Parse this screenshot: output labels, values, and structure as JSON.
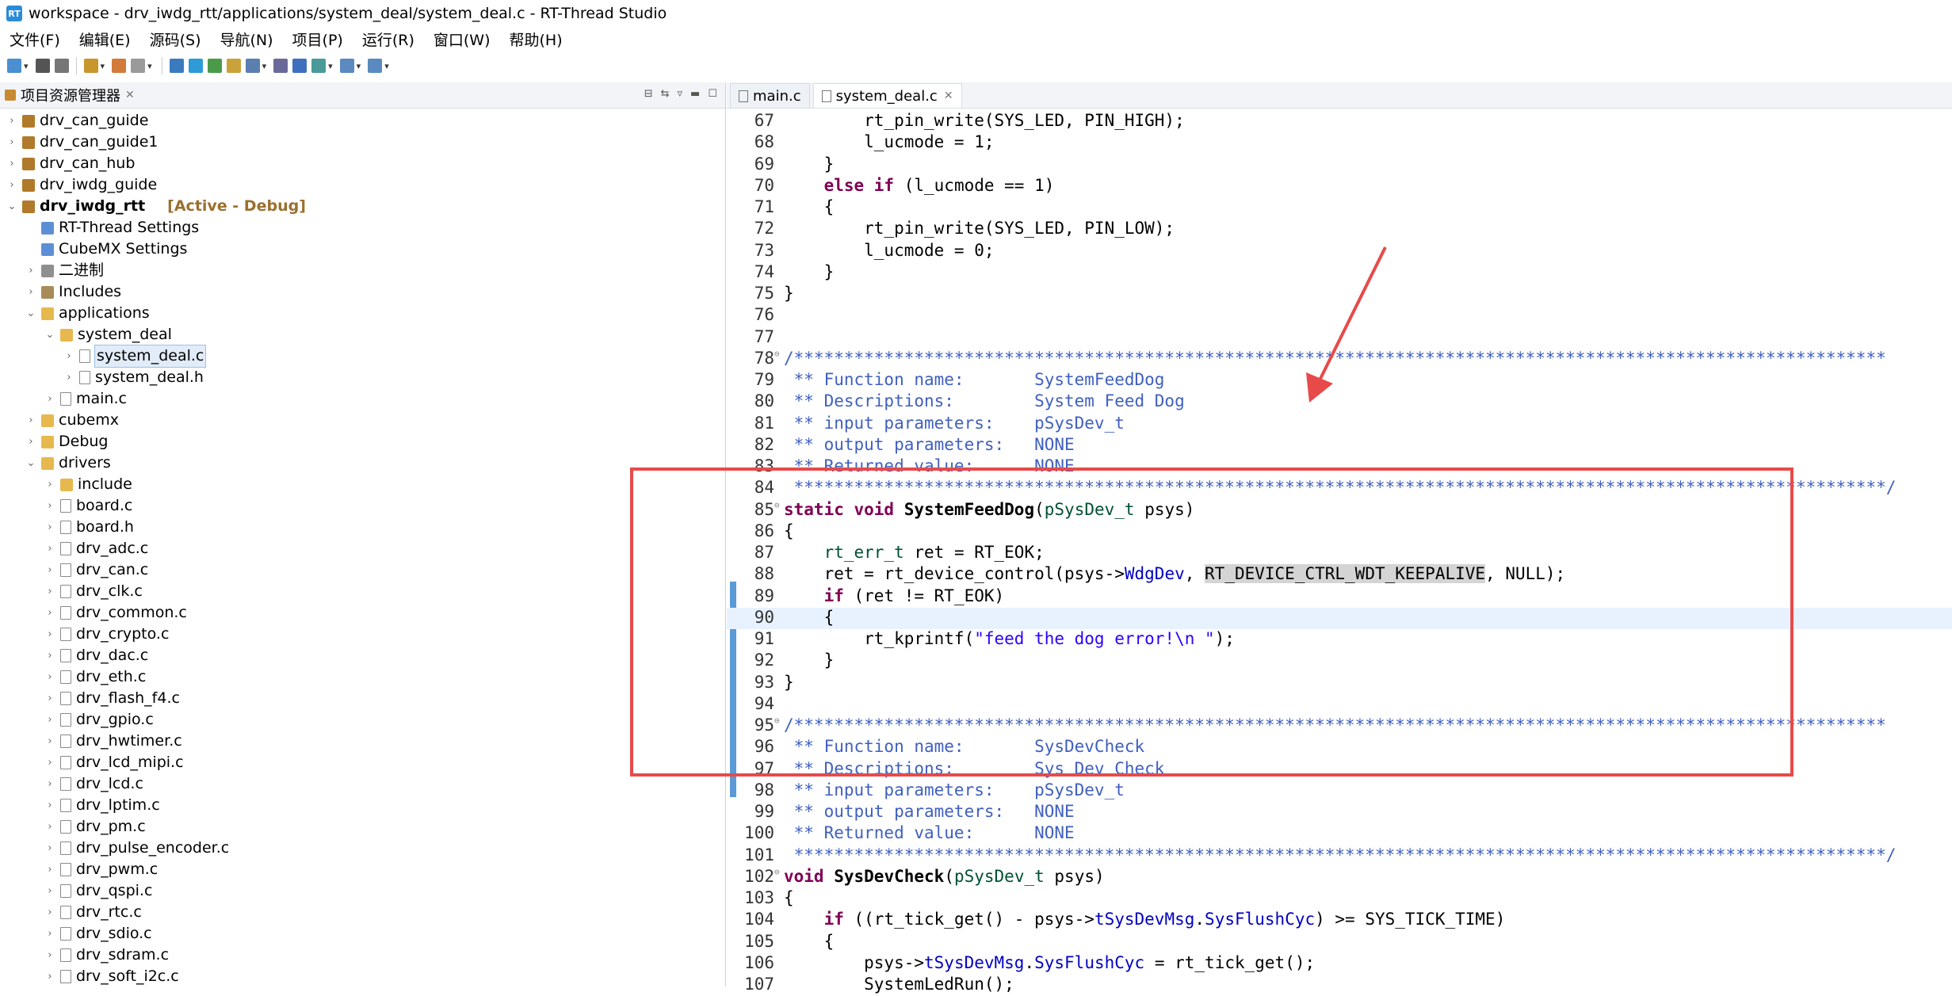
{
  "window": {
    "title": "workspace - drv_iwdg_rtt/applications/system_deal/system_deal.c - RT-Thread Studio"
  },
  "menubar": [
    "文件(F)",
    "编辑(E)",
    "源码(S)",
    "导航(N)",
    "项目(P)",
    "运行(R)",
    "窗口(W)",
    "帮助(H)"
  ],
  "explorer": {
    "title": "项目资源管理器",
    "active_tag": "[Active - Debug]",
    "items": [
      {
        "label": "drv_can_guide",
        "level": 0,
        "chev": "›",
        "icon": "proj"
      },
      {
        "label": "drv_can_guide1",
        "level": 0,
        "chev": "›",
        "icon": "proj"
      },
      {
        "label": "drv_can_hub",
        "level": 0,
        "chev": "›",
        "icon": "proj"
      },
      {
        "label": "drv_iwdg_guide",
        "level": 0,
        "chev": "›",
        "icon": "proj"
      },
      {
        "label": "drv_iwdg_rtt",
        "level": 0,
        "chev": "⌄",
        "icon": "proj",
        "bold": true,
        "active": true
      },
      {
        "label": "RT-Thread Settings",
        "level": 1,
        "chev": "",
        "icon": "cfg"
      },
      {
        "label": "CubeMX Settings",
        "level": 1,
        "chev": "",
        "icon": "cfg"
      },
      {
        "label": "二进制",
        "level": 1,
        "chev": "›",
        "icon": "bin"
      },
      {
        "label": "Includes",
        "level": 1,
        "chev": "›",
        "icon": "inc"
      },
      {
        "label": "applications",
        "level": 1,
        "chev": "⌄",
        "icon": "folder"
      },
      {
        "label": "system_deal",
        "level": 2,
        "chev": "⌄",
        "icon": "folder"
      },
      {
        "label": "system_deal.c",
        "level": 3,
        "chev": "›",
        "icon": "file",
        "selected": true
      },
      {
        "label": "system_deal.h",
        "level": 3,
        "chev": "›",
        "icon": "file"
      },
      {
        "label": "main.c",
        "level": 2,
        "chev": "›",
        "icon": "file"
      },
      {
        "label": "cubemx",
        "level": 1,
        "chev": "›",
        "icon": "folder"
      },
      {
        "label": "Debug",
        "level": 1,
        "chev": "›",
        "icon": "folder"
      },
      {
        "label": "drivers",
        "level": 1,
        "chev": "⌄",
        "icon": "folder"
      },
      {
        "label": "include",
        "level": 2,
        "chev": "›",
        "icon": "folder"
      },
      {
        "label": "board.c",
        "level": 2,
        "chev": "›",
        "icon": "file"
      },
      {
        "label": "board.h",
        "level": 2,
        "chev": "›",
        "icon": "file"
      },
      {
        "label": "drv_adc.c",
        "level": 2,
        "chev": "›",
        "icon": "file"
      },
      {
        "label": "drv_can.c",
        "level": 2,
        "chev": "›",
        "icon": "file"
      },
      {
        "label": "drv_clk.c",
        "level": 2,
        "chev": "›",
        "icon": "file"
      },
      {
        "label": "drv_common.c",
        "level": 2,
        "chev": "›",
        "icon": "file"
      },
      {
        "label": "drv_crypto.c",
        "level": 2,
        "chev": "›",
        "icon": "file"
      },
      {
        "label": "drv_dac.c",
        "level": 2,
        "chev": "›",
        "icon": "file"
      },
      {
        "label": "drv_eth.c",
        "level": 2,
        "chev": "›",
        "icon": "file"
      },
      {
        "label": "drv_flash_f4.c",
        "level": 2,
        "chev": "›",
        "icon": "file"
      },
      {
        "label": "drv_gpio.c",
        "level": 2,
        "chev": "›",
        "icon": "file"
      },
      {
        "label": "drv_hwtimer.c",
        "level": 2,
        "chev": "›",
        "icon": "file"
      },
      {
        "label": "drv_lcd_mipi.c",
        "level": 2,
        "chev": "›",
        "icon": "file"
      },
      {
        "label": "drv_lcd.c",
        "level": 2,
        "chev": "›",
        "icon": "file"
      },
      {
        "label": "drv_lptim.c",
        "level": 2,
        "chev": "›",
        "icon": "file"
      },
      {
        "label": "drv_pm.c",
        "level": 2,
        "chev": "›",
        "icon": "file"
      },
      {
        "label": "drv_pulse_encoder.c",
        "level": 2,
        "chev": "›",
        "icon": "file"
      },
      {
        "label": "drv_pwm.c",
        "level": 2,
        "chev": "›",
        "icon": "file"
      },
      {
        "label": "drv_qspi.c",
        "level": 2,
        "chev": "›",
        "icon": "file"
      },
      {
        "label": "drv_rtc.c",
        "level": 2,
        "chev": "›",
        "icon": "file"
      },
      {
        "label": "drv_sdio.c",
        "level": 2,
        "chev": "›",
        "icon": "file"
      },
      {
        "label": "drv_sdram.c",
        "level": 2,
        "chev": "›",
        "icon": "file"
      },
      {
        "label": "drv_soft_i2c.c",
        "level": 2,
        "chev": "›",
        "icon": "file"
      }
    ]
  },
  "editor": {
    "tabs": [
      {
        "label": "main.c",
        "active": false
      },
      {
        "label": "system_deal.c",
        "active": true
      }
    ],
    "lines": [
      {
        "n": "67",
        "fold": "",
        "segs": [
          [
            "",
            "        rt_pin_write(SYS_LED, PIN_HIGH);"
          ]
        ]
      },
      {
        "n": "68",
        "fold": "",
        "segs": [
          [
            "",
            "        l_ucmode = 1;"
          ]
        ]
      },
      {
        "n": "69",
        "fold": "",
        "segs": [
          [
            "",
            "    }"
          ]
        ]
      },
      {
        "n": "70",
        "fold": "",
        "segs": [
          [
            "",
            "    "
          ],
          [
            "kw",
            "else if"
          ],
          [
            "",
            " (l_ucmode == 1)"
          ]
        ]
      },
      {
        "n": "71",
        "fold": "",
        "segs": [
          [
            "",
            "    {"
          ]
        ]
      },
      {
        "n": "72",
        "fold": "",
        "segs": [
          [
            "",
            "        rt_pin_write(SYS_LED, PIN_LOW);"
          ]
        ]
      },
      {
        "n": "73",
        "fold": "",
        "segs": [
          [
            "",
            "        l_ucmode = 0;"
          ]
        ]
      },
      {
        "n": "74",
        "fold": "",
        "segs": [
          [
            "",
            "    }"
          ]
        ]
      },
      {
        "n": "75",
        "fold": "",
        "segs": [
          [
            "",
            "}"
          ]
        ]
      },
      {
        "n": "76",
        "fold": "",
        "segs": []
      },
      {
        "n": "77",
        "fold": "",
        "segs": []
      },
      {
        "n": "78",
        "fold": "⊖",
        "segs": [
          [
            "cm",
            "/*************************************************************************************************************"
          ]
        ]
      },
      {
        "n": "79",
        "fold": "",
        "segs": [
          [
            "cm",
            " ** Function name:       SystemFeedDog"
          ]
        ]
      },
      {
        "n": "80",
        "fold": "",
        "segs": [
          [
            "cm",
            " ** Descriptions:        System Feed Dog"
          ]
        ]
      },
      {
        "n": "81",
        "fold": "",
        "segs": [
          [
            "cm",
            " ** input parameters:    pSysDev_t"
          ]
        ]
      },
      {
        "n": "82",
        "fold": "",
        "segs": [
          [
            "cm",
            " ** output parameters:   NONE"
          ]
        ]
      },
      {
        "n": "83",
        "fold": "",
        "segs": [
          [
            "cm",
            " ** Returned value:      NONE"
          ]
        ]
      },
      {
        "n": "84",
        "fold": "",
        "segs": [
          [
            "cm",
            " *************************************************************************************************************/"
          ]
        ]
      },
      {
        "n": "85",
        "fold": "⊖",
        "segs": [
          [
            "kw",
            "static void"
          ],
          [
            "",
            " "
          ],
          [
            "fn",
            "SystemFeedDog"
          ],
          [
            "",
            "("
          ],
          [
            "ty",
            "pSysDev_t"
          ],
          [
            "",
            " psys)"
          ]
        ]
      },
      {
        "n": "86",
        "fold": "",
        "segs": [
          [
            "",
            "{"
          ]
        ]
      },
      {
        "n": "87",
        "fold": "",
        "segs": [
          [
            "",
            "    "
          ],
          [
            "ty",
            "rt_err_t"
          ],
          [
            "",
            " ret = RT_EOK;"
          ]
        ]
      },
      {
        "n": "88",
        "fold": "",
        "segs": [
          [
            "",
            "    ret = rt_device_control(psys->"
          ],
          [
            "mb",
            "WdgDev"
          ],
          [
            "",
            ", "
          ],
          [
            "macbg",
            "RT_DEVICE_CTRL_WDT_KEEPALIVE"
          ],
          [
            "",
            ", NULL);"
          ]
        ]
      },
      {
        "n": "89",
        "fold": "",
        "segs": [
          [
            "",
            "    "
          ],
          [
            "kw",
            "if"
          ],
          [
            "",
            " (ret != RT_EOK)"
          ]
        ]
      },
      {
        "n": "90",
        "fold": "",
        "hl": true,
        "segs": [
          [
            "",
            "    {"
          ]
        ]
      },
      {
        "n": "91",
        "fold": "",
        "segs": [
          [
            "",
            "        rt_kprintf("
          ],
          [
            "str",
            "\"feed the dog error!\\n \""
          ],
          [
            "",
            ");"
          ]
        ]
      },
      {
        "n": "92",
        "fold": "",
        "segs": [
          [
            "",
            "    }"
          ]
        ]
      },
      {
        "n": "93",
        "fold": "",
        "segs": [
          [
            "",
            "}"
          ]
        ]
      },
      {
        "n": "94",
        "fold": "",
        "segs": []
      },
      {
        "n": "95",
        "fold": "⊖",
        "segs": [
          [
            "cm",
            "/*************************************************************************************************************"
          ]
        ]
      },
      {
        "n": "96",
        "fold": "",
        "segs": [
          [
            "cm",
            " ** Function name:       SysDevCheck"
          ]
        ]
      },
      {
        "n": "97",
        "fold": "",
        "segs": [
          [
            "cm",
            " ** Descriptions:        Sys Dev Check"
          ]
        ]
      },
      {
        "n": "98",
        "fold": "",
        "segs": [
          [
            "cm",
            " ** input parameters:    pSysDev_t"
          ]
        ]
      },
      {
        "n": "99",
        "fold": "",
        "segs": [
          [
            "cm",
            " ** output parameters:   NONE"
          ]
        ]
      },
      {
        "n": "100",
        "fold": "",
        "segs": [
          [
            "cm",
            " ** Returned value:      NONE"
          ]
        ]
      },
      {
        "n": "101",
        "fold": "",
        "segs": [
          [
            "cm",
            " *************************************************************************************************************/"
          ]
        ]
      },
      {
        "n": "102",
        "fold": "⊖",
        "segs": [
          [
            "kw",
            "void"
          ],
          [
            "",
            " "
          ],
          [
            "fn",
            "SysDevCheck"
          ],
          [
            "",
            "("
          ],
          [
            "ty",
            "pSysDev_t"
          ],
          [
            "",
            " psys)"
          ]
        ]
      },
      {
        "n": "103",
        "fold": "",
        "segs": [
          [
            "",
            "{"
          ]
        ]
      },
      {
        "n": "104",
        "fold": "",
        "segs": [
          [
            "",
            "    "
          ],
          [
            "kw",
            "if"
          ],
          [
            "",
            " ((rt_tick_get() - psys->"
          ],
          [
            "mb",
            "tSysDevMsg"
          ],
          [
            "",
            "."
          ],
          [
            "mb",
            "SysFlushCyc"
          ],
          [
            "",
            ") >= SYS_TICK_TIME)"
          ]
        ]
      },
      {
        "n": "105",
        "fold": "",
        "segs": [
          [
            "",
            "    {"
          ]
        ]
      },
      {
        "n": "106",
        "fold": "",
        "segs": [
          [
            "",
            "        psys->"
          ],
          [
            "mb",
            "tSysDevMsg"
          ],
          [
            "",
            "."
          ],
          [
            "mb",
            "SysFlushCyc"
          ],
          [
            "",
            " = rt_tick_get();"
          ]
        ]
      },
      {
        "n": "107",
        "fold": "",
        "segs": [
          [
            "",
            "        SystemLedRun();"
          ]
        ]
      }
    ]
  },
  "colors": {
    "annotation": "#e84a4a",
    "accent": "#5a9ad6"
  }
}
